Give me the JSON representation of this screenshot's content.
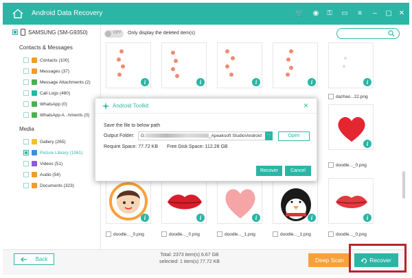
{
  "app": {
    "title": "Android Data Recovery"
  },
  "device": {
    "name": "SAMSUNG (SM-G9350)"
  },
  "sidebar": {
    "cat1": "Contacts & Messages",
    "cat2": "Media",
    "items": [
      {
        "label": "Contacts (100)",
        "color": "#f29b2f"
      },
      {
        "label": "Messages (37)",
        "color": "#f29b2f"
      },
      {
        "label": "Message Attachments (2)",
        "color": "#4caf50"
      },
      {
        "label": "Call Logs (480)",
        "color": "#2bb5a5"
      },
      {
        "label": "WhatsApp (0)",
        "color": "#4caf50"
      },
      {
        "label": "WhatsApp A...hments (0)",
        "color": "#4caf50"
      },
      {
        "label": "Gallery (265)",
        "color": "#f2c12e"
      },
      {
        "label": "Picture Library (1061)",
        "color": "#3b8fe0"
      },
      {
        "label": "Videos (51)",
        "color": "#8e5bd6"
      },
      {
        "label": "Audio (54)",
        "color": "#f29b2f"
      },
      {
        "label": "Documents (323)",
        "color": "#f29b2f"
      }
    ]
  },
  "filter": {
    "toggle": "OFF",
    "label": "Only display the deleted item(s)"
  },
  "grid": {
    "row1": [
      "dazhao...22.png"
    ],
    "row2": [
      "doodle..._0.png"
    ],
    "row3": [
      "doodle..._0.png",
      "doodle..._0.png",
      "doodle..._1.png",
      "doodle..._1.png",
      "doodle..._0.png"
    ],
    "info": "i"
  },
  "dialog": {
    "title": "Android Toolkit",
    "close": "×",
    "save_text": "Save the file to below path",
    "output_label": "Output Folder:",
    "path_start": "G:",
    "path_end": "_Apeaksoft Studio\\Android",
    "browse": "···",
    "open": "Open",
    "require": "Require Space: 77.72 KB",
    "free": "Free Disk Space: 112.28 GB",
    "recover": "Recover",
    "cancel": "Cancel"
  },
  "footer": {
    "back": "Back",
    "total": "Total: 2373 item(s) 6.67 GB",
    "selected": "selected: 1 item(s) 77.72 KB",
    "deep_scan": "Deep Scan",
    "recover": "Recover"
  }
}
